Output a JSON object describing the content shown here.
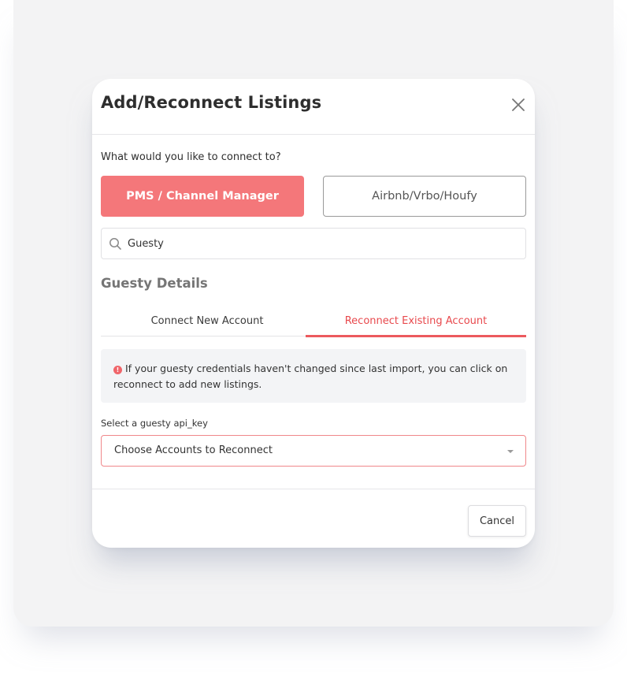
{
  "modal": {
    "title": "Add/Reconnect Listings",
    "close_icon": "close-icon"
  },
  "connect": {
    "question": "What would you like to connect to?",
    "options": [
      {
        "label": "PMS / Channel Manager",
        "selected": true
      },
      {
        "label": "Airbnb/Vrbo/Houfy",
        "selected": false
      }
    ]
  },
  "search": {
    "icon": "search-icon",
    "value": "Guesty"
  },
  "details": {
    "title": "Guesty Details",
    "tabs": [
      {
        "label": "Connect New Account",
        "active": false
      },
      {
        "label": "Reconnect Existing Account",
        "active": true
      }
    ],
    "info_icon": "info-icon",
    "info_text": "If your guesty credentials haven't changed since last import, you can click on reconnect to add new listings.",
    "select_label": "Select a guesty api_key",
    "select_value": "Choose Accounts to Reconnect",
    "select_icon": "caret-down-icon"
  },
  "footer": {
    "cancel_label": "Cancel"
  },
  "colors": {
    "accent": "#f4777a",
    "tab_active": "#e8494d",
    "info_icon": "#f0656a",
    "backdrop": "#f3f3f4"
  }
}
